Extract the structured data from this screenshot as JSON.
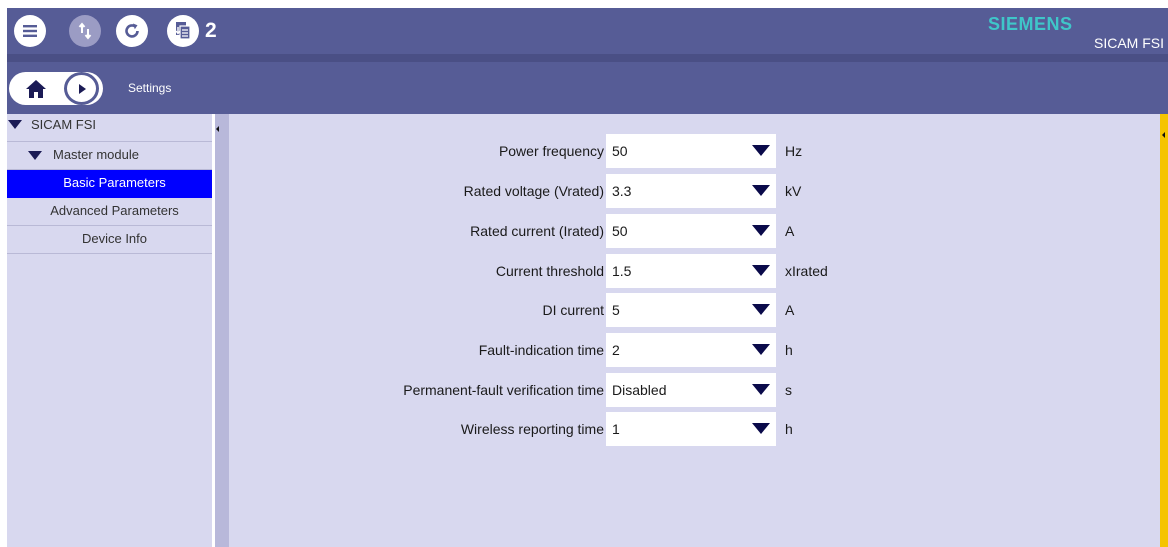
{
  "header": {
    "menu_icon": "hamburger-menu-icon",
    "transfer_icon": "upload-download-icon",
    "refresh_icon": "refresh-icon",
    "pending_icon": "document-download-icon",
    "pending_count": "2",
    "brand": "SIEMENS",
    "product": "SICAM FSI",
    "brand_color": "#3fc6c9"
  },
  "breadcrumb": {
    "home_icon": "home-icon",
    "forward_icon": "play-forward-icon",
    "current": "Settings"
  },
  "sidebar": {
    "root": "SICAM FSI",
    "module": "Master module",
    "items": [
      {
        "label": "Basic Parameters",
        "selected": true
      },
      {
        "label": "Advanced Parameters",
        "selected": false
      },
      {
        "label": "Device Info",
        "selected": false
      }
    ],
    "selected_color": "#0000ff"
  },
  "parameters": [
    {
      "label": "Power frequency",
      "value": "50",
      "unit": "Hz"
    },
    {
      "label": "Rated voltage (Vrated)",
      "value": "3.3",
      "unit": "kV"
    },
    {
      "label": "Rated current (Irated)",
      "value": "50",
      "unit": "A"
    },
    {
      "label": "Current threshold",
      "value": "1.5",
      "unit": "xIrated"
    },
    {
      "label": "DI current",
      "value": "5",
      "unit": "A"
    },
    {
      "label": "Fault-indication time",
      "value": "2",
      "unit": "h"
    },
    {
      "label": "Permanent-fault verification time",
      "value": "Disabled",
      "unit": "s"
    },
    {
      "label": "Wireless reporting time",
      "value": "1",
      "unit": "h"
    }
  ],
  "theme": {
    "header_bg": "#565c96",
    "panel_bg": "#d8d8ef",
    "rail_color": "#f5c400"
  }
}
